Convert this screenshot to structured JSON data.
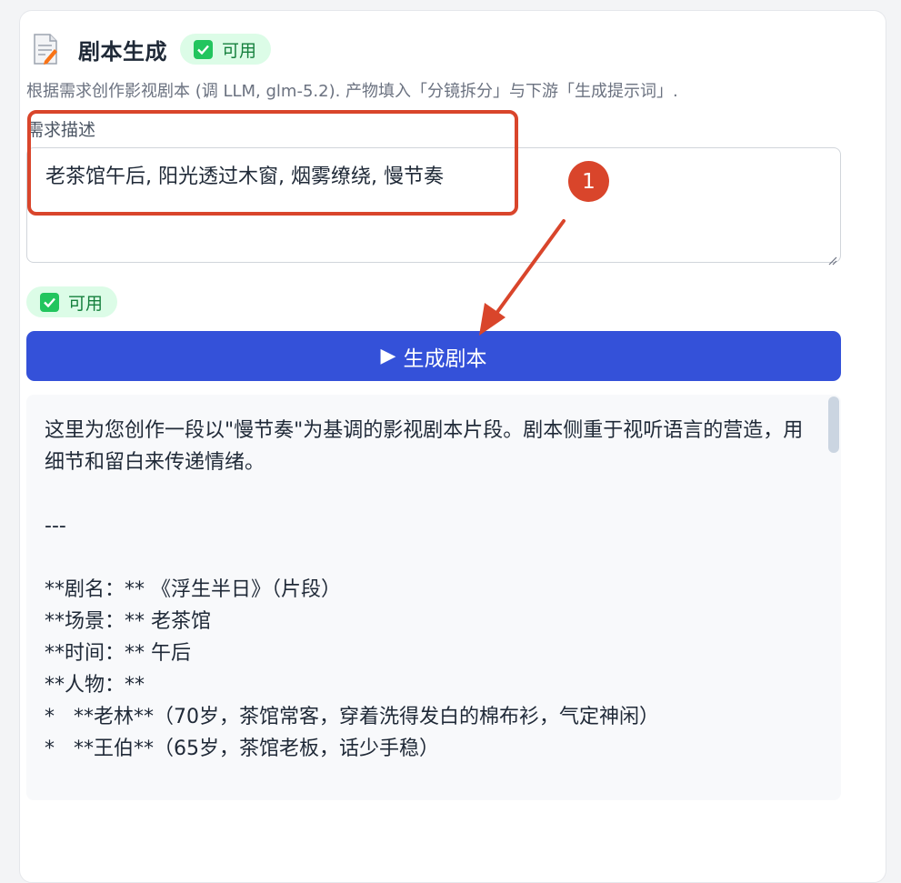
{
  "header": {
    "title": "剧本生成",
    "status_badge": "可用"
  },
  "description": "根据需求创作影视剧本 (调 LLM, glm-5.2). 产物填入「分镜拆分」与下游「生成提示词」.",
  "input": {
    "label": "需求描述",
    "value": "老茶馆午后, 阳光透过木窗, 烟雾缭绕, 慢节奏"
  },
  "status_badge_2": "可用",
  "generate_button": {
    "icon": "▶",
    "label": "生成剧本"
  },
  "output": {
    "text": "这里为您创作一段以\"慢节奏\"为基调的影视剧本片段。剧本侧重于视听语言的营造，用细节和留白来传递情绪。\n\n---\n\n**剧名：** 《浮生半日》（片段）\n**场景：** 老茶馆\n**时间：** 午后\n**人物：**\n*   **老林**（70岁，茶馆常客，穿着洗得发白的棉布衫，气定神闲）\n*   **王伯**（65岁，茶馆老板，话少手稳）\n\n---"
  },
  "annotation": {
    "step_number": "1"
  },
  "colors": {
    "accent": "#3451d9",
    "annotation": "#d9452b",
    "badge_bg": "#dcfce7",
    "badge_text": "#15803d"
  }
}
